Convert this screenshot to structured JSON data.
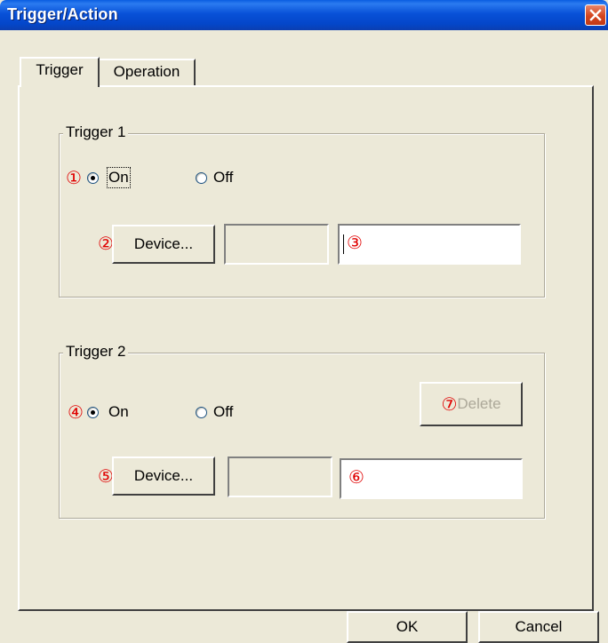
{
  "window": {
    "title": "Trigger/Action"
  },
  "tabs": {
    "trigger": "Trigger",
    "operation": "Operation"
  },
  "trigger1": {
    "legend": "Trigger 1",
    "marker_state": "①",
    "on_label": "On",
    "off_label": "Off",
    "selected": "On",
    "marker_device": "②",
    "device_label": "Device...",
    "device_value": "",
    "marker_field": "③",
    "field_value": ""
  },
  "trigger2": {
    "legend": "Trigger 2",
    "marker_state": "④",
    "on_label": "On",
    "off_label": "Off",
    "selected": "On",
    "marker_device": "⑤",
    "device_label": "Device...",
    "device_value": "",
    "marker_field": "⑥",
    "field_value": "",
    "marker_delete": "⑦",
    "delete_label": "Delete",
    "delete_enabled": false
  },
  "footer": {
    "ok_label": "OK",
    "cancel_label": "Cancel"
  },
  "colors": {
    "titlebar": "#0851d8",
    "marker": "#e00000",
    "dialog_bg": "#ece9d8"
  }
}
